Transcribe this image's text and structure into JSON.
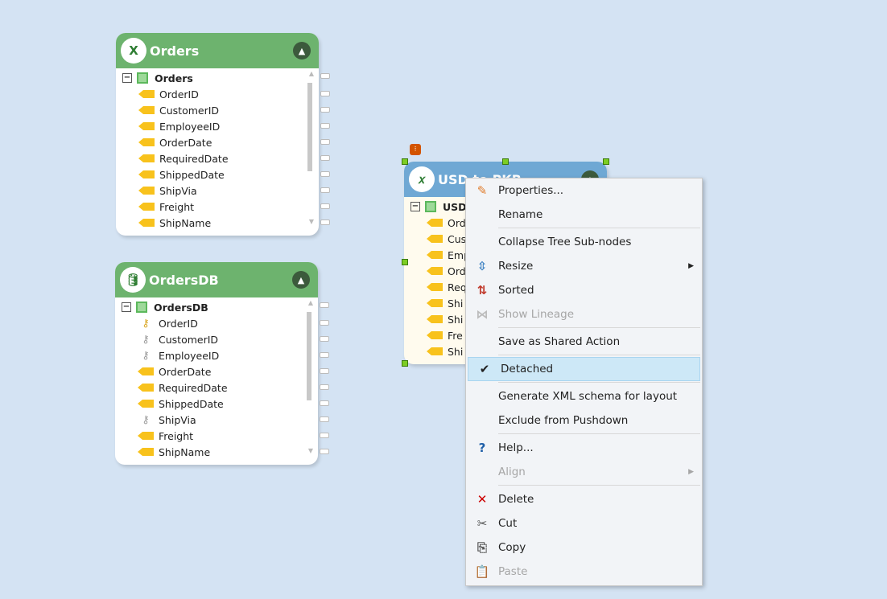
{
  "components": [
    {
      "title": "Orders",
      "header_color": "#6db36e",
      "root": "Orders",
      "icon": "excel-file-icon",
      "fields": [
        {
          "name": "OrderID",
          "type": "field"
        },
        {
          "name": "CustomerID",
          "type": "field"
        },
        {
          "name": "EmployeeID",
          "type": "field"
        },
        {
          "name": "OrderDate",
          "type": "field"
        },
        {
          "name": "RequiredDate",
          "type": "field"
        },
        {
          "name": "ShippedDate",
          "type": "field"
        },
        {
          "name": "ShipVia",
          "type": "field"
        },
        {
          "name": "Freight",
          "type": "field"
        },
        {
          "name": "ShipName",
          "type": "field"
        }
      ]
    },
    {
      "title": "OrdersDB",
      "header_color": "#6db36e",
      "root": "OrdersDB",
      "icon": "database-icon",
      "fields": [
        {
          "name": "OrderID",
          "type": "primary-key"
        },
        {
          "name": "CustomerID",
          "type": "foreign-key"
        },
        {
          "name": "EmployeeID",
          "type": "foreign-key"
        },
        {
          "name": "OrderDate",
          "type": "field"
        },
        {
          "name": "RequiredDate",
          "type": "field"
        },
        {
          "name": "ShippedDate",
          "type": "field"
        },
        {
          "name": "ShipVia",
          "type": "foreign-key"
        },
        {
          "name": "Freight",
          "type": "field"
        },
        {
          "name": "ShipName",
          "type": "field"
        }
      ]
    },
    {
      "title": "USD to PKR",
      "header_color": "#6fa8d4",
      "root": "USD",
      "icon": "expression-icon",
      "fields": [
        {
          "name": "Ord"
        },
        {
          "name": "Cus"
        },
        {
          "name": "Emp"
        },
        {
          "name": "Ord"
        },
        {
          "name": "Req"
        },
        {
          "name": "Shi"
        },
        {
          "name": "Shi"
        },
        {
          "name": "Fre"
        },
        {
          "name": "Shi"
        }
      ]
    }
  ],
  "context_menu": {
    "items": [
      {
        "label": "Properties...",
        "icon": "properties-icon",
        "enabled": true
      },
      {
        "label": "Rename",
        "enabled": true
      },
      {
        "separator": true
      },
      {
        "label": "Collapse Tree Sub-nodes",
        "enabled": true
      },
      {
        "label": "Resize",
        "icon": "resize-icon",
        "enabled": true,
        "submenu": true
      },
      {
        "label": "Sorted",
        "icon": "sort-icon",
        "enabled": true
      },
      {
        "label": "Show Lineage",
        "icon": "lineage-icon",
        "enabled": false
      },
      {
        "separator": true
      },
      {
        "label": "Save as Shared Action",
        "enabled": true
      },
      {
        "separator": true
      },
      {
        "label": "Detached",
        "checked": true,
        "enabled": true
      },
      {
        "separator": true
      },
      {
        "label": "Generate XML schema for layout",
        "enabled": true
      },
      {
        "label": "Exclude from Pushdown",
        "enabled": true
      },
      {
        "separator": true
      },
      {
        "label": "Help...",
        "icon": "help-icon",
        "enabled": true
      },
      {
        "label": "Align",
        "enabled": false,
        "submenu": true
      },
      {
        "separator": true
      },
      {
        "label": "Delete",
        "icon": "delete-icon",
        "enabled": true
      },
      {
        "label": "Cut",
        "icon": "cut-icon",
        "enabled": true
      },
      {
        "label": "Copy",
        "icon": "copy-icon",
        "enabled": true
      },
      {
        "label": "Paste",
        "icon": "paste-icon",
        "enabled": false
      }
    ]
  }
}
